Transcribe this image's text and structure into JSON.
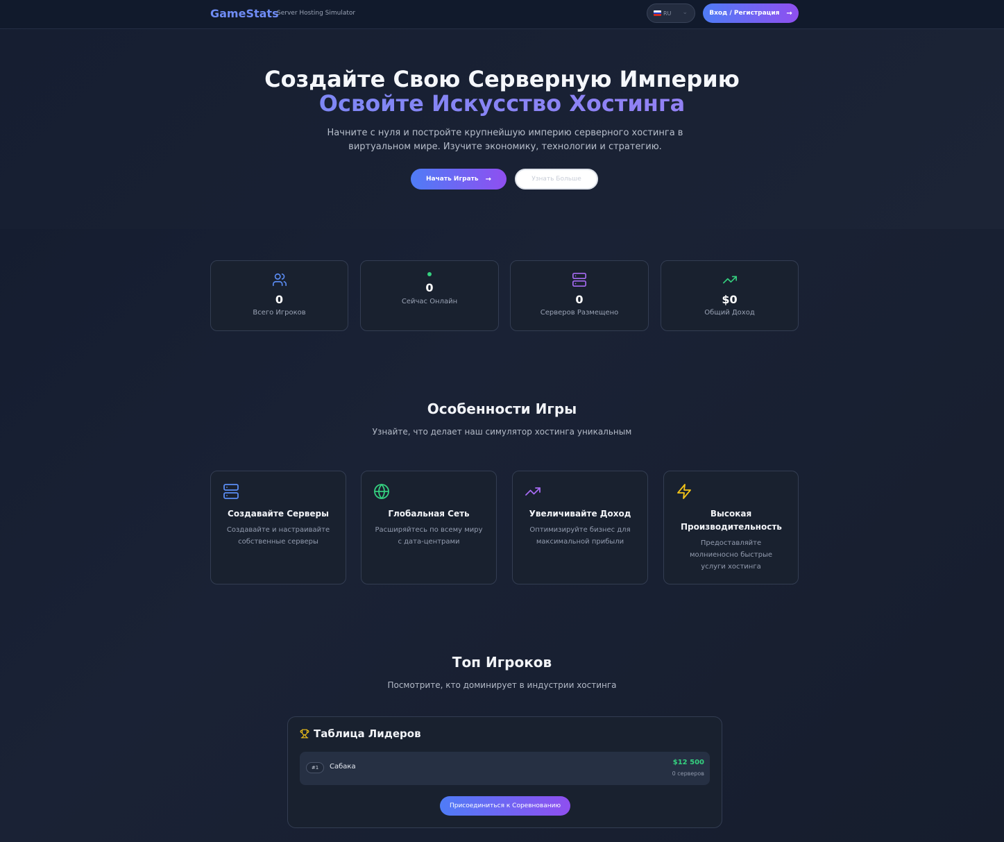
{
  "header": {
    "brand": "GameStats",
    "brand_sub": "Server Hosting Simulator",
    "lang_code": "RU",
    "login_label": "Вход / Регистрация"
  },
  "hero": {
    "title_line1": "Создайте Свою Серверную Империю",
    "title_line2": "Освойте Искусство Хостинга",
    "description": "Начните с нуля и постройте крупнейшую империю серверного хостинга в виртуальном мире. Изучите экономику, технологии и стратегию.",
    "play_label": "Начать Играть",
    "more_label": "Узнать Больше"
  },
  "stats": [
    {
      "icon": "users-icon",
      "value": "0",
      "label": "Всего Игроков"
    },
    {
      "icon": "online-dot",
      "value": "0",
      "label": "Сейчас Онлайн"
    },
    {
      "icon": "server-icon",
      "value": "0",
      "label": "Серверов Размещено"
    },
    {
      "icon": "trending-up-icon",
      "value": "$0",
      "label": "Общий Доход"
    }
  ],
  "features": {
    "title": "Особенности Игры",
    "subtitle": "Узнайте, что делает наш симулятор хостинга уникальным",
    "items": [
      {
        "icon": "server-icon",
        "title": "Создавайте Серверы",
        "desc": "Создавайте и настраивайте собственные серверы"
      },
      {
        "icon": "globe-icon",
        "title": "Глобальная Сеть",
        "desc": "Расширяйтесь по всему миру с дата-центрами"
      },
      {
        "icon": "trending-up-icon",
        "title": "Увеличивайте Доход",
        "desc": "Оптимизируйте бизнес для максимальной прибыли"
      },
      {
        "icon": "lightning-icon",
        "title": "Высокая Производительность",
        "desc": "Предоставляйте молниеносно быстрые услуги хостинга"
      }
    ]
  },
  "top_players": {
    "title": "Топ Игроков",
    "subtitle": "Посмотрите, кто доминирует в индустрии хостинга",
    "board_title": "Таблица Лидеров",
    "rows": [
      {
        "rank": "#1",
        "name": "Сабака",
        "money": "$12 500",
        "servers": "0 серверов"
      }
    ],
    "join_label": "Присоединиться к Соревнованию"
  },
  "colors": {
    "accent_start": "#4f7cf6",
    "accent_end": "#8f4ff0",
    "green": "#35d07f",
    "yellow": "#f5c518",
    "purple": "#a66bf2",
    "blue": "#5b8df5"
  }
}
